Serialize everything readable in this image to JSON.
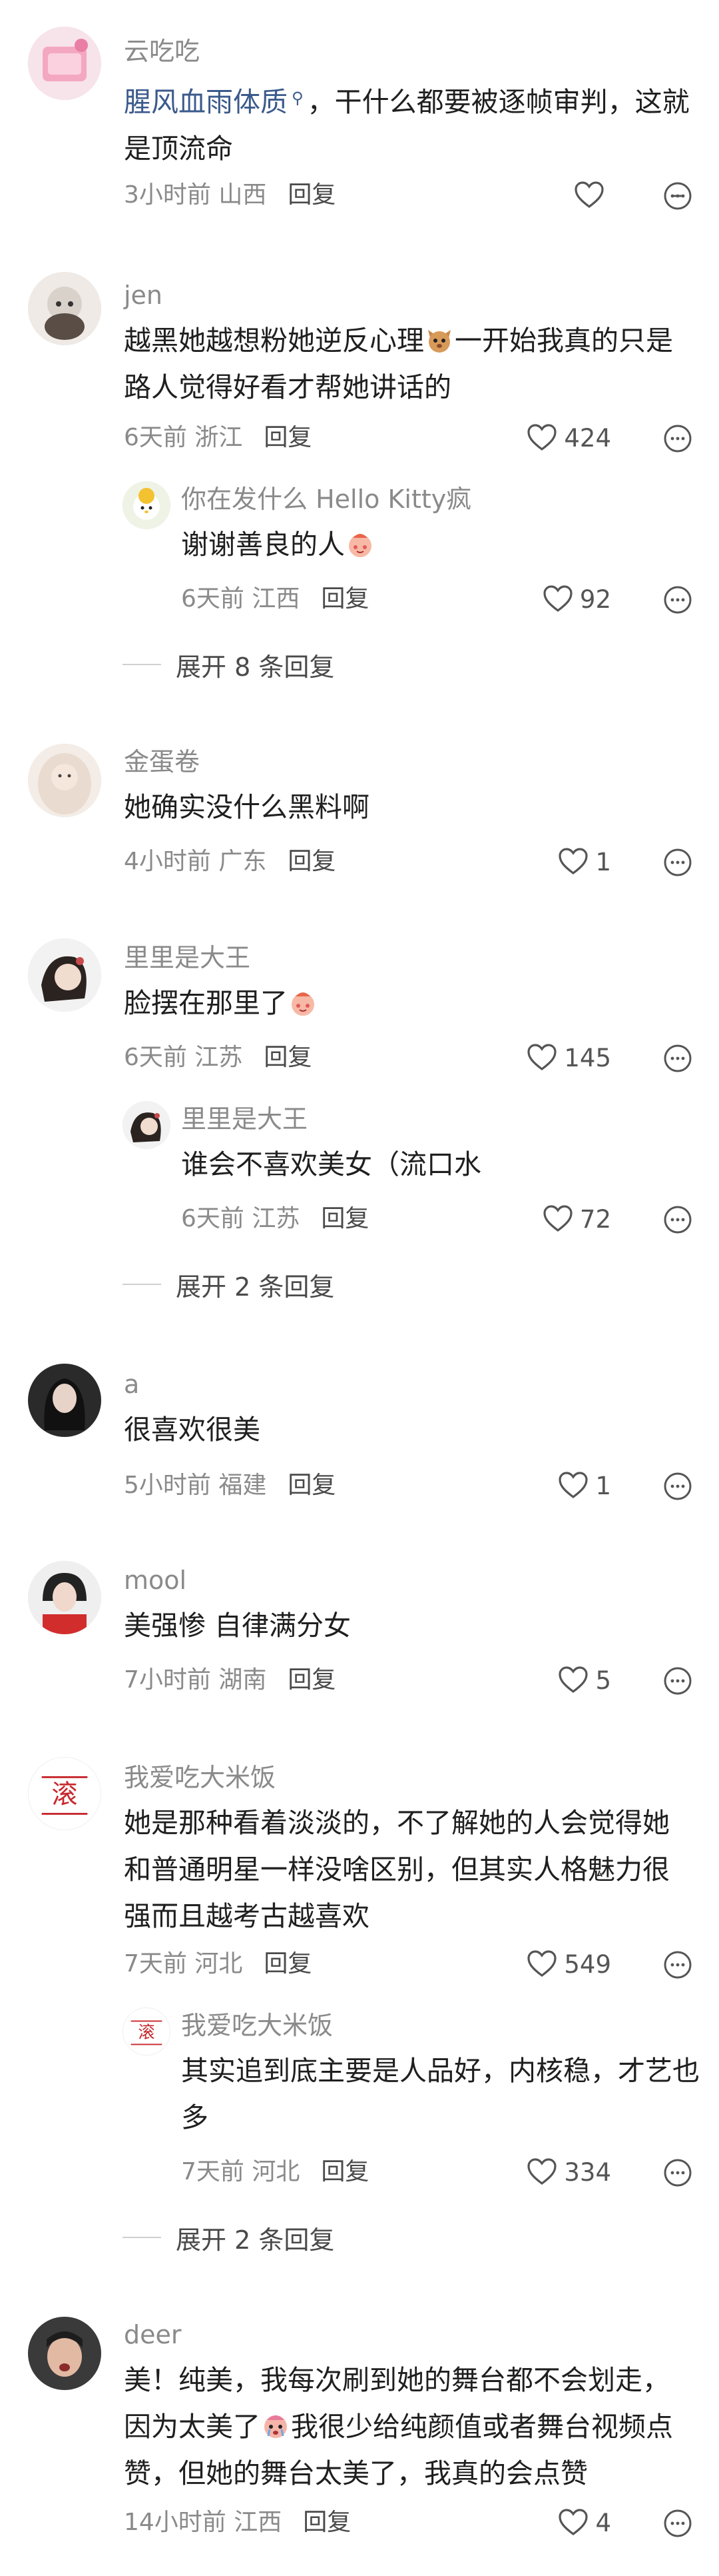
{
  "comments": [
    {
      "user": "云吃吃",
      "text_link": "腥风血雨体质",
      "text_link_icon": "search-icon",
      "text_rest": "，干什么都要被逐帧审判，这就是顶流命",
      "time": "3小时前",
      "location": "山西",
      "reply_label": "回复",
      "likes": ""
    },
    {
      "user": "jen",
      "text_a": "越黑她越想粉她逆反心理",
      "text_emoji": "cat-emoji",
      "text_b": "一开始我真的只是路人觉得好看才帮她讲话的",
      "time": "6天前",
      "location": "浙江",
      "reply_label": "回复",
      "likes": "424",
      "reply": {
        "user": "你在发什么 Hello Kitty疯",
        "text": "谢谢善良的人",
        "text_emoji": "blush-emoji",
        "time": "6天前",
        "location": "江西",
        "reply_label": "回复",
        "likes": "92"
      },
      "expand": "展开 8 条回复"
    },
    {
      "user": "金蛋卷",
      "text": "她确实没什么黑料啊",
      "time": "4小时前",
      "location": "广东",
      "reply_label": "回复",
      "likes": "1"
    },
    {
      "user": "里里是大王",
      "text": "脸摆在那里了",
      "text_emoji": "blush-emoji",
      "time": "6天前",
      "location": "江苏",
      "reply_label": "回复",
      "likes": "145",
      "reply": {
        "user": "里里是大王",
        "text": "谁会不喜欢美女（流口水",
        "time": "6天前",
        "location": "江苏",
        "reply_label": "回复",
        "likes": "72"
      },
      "expand": "展开 2 条回复"
    },
    {
      "user": "a",
      "text": "很喜欢很美",
      "time": "5小时前",
      "location": "福建",
      "reply_label": "回复",
      "likes": "1"
    },
    {
      "user": "mool",
      "text": "美强惨 自律满分女",
      "time": "7小时前",
      "location": "湖南",
      "reply_label": "回复",
      "likes": "5"
    },
    {
      "user": "我爱吃大米饭",
      "text": "她是那种看着淡淡的，不了解她的人会觉得她和普通明星一样没啥区别，但其实人格魅力很强而且越考古越喜欢",
      "time": "7天前",
      "location": "河北",
      "reply_label": "回复",
      "likes": "549",
      "avatar_text": "滚",
      "reply": {
        "user": "我爱吃大米饭",
        "text": "其实追到底主要是人品好，内核稳，才艺也多",
        "time": "7天前",
        "location": "河北",
        "reply_label": "回复",
        "likes": "334",
        "avatar_text": "滚"
      },
      "expand": "展开 2 条回复"
    },
    {
      "user": "deer",
      "text_a": "美！纯美，我每次刷到她的舞台都不会划走，因为太美了",
      "text_emoji": "crying-emoji",
      "text_b": "我很少给纯颜值或者舞台视频点赞，但她的舞台太美了，我真的会点赞",
      "time": "14小时前",
      "location": "江西",
      "reply_label": "回复",
      "likes": "4"
    }
  ],
  "colors": {
    "username": "#8a8a8a",
    "text": "#1f1f1f",
    "link": "#3b5a8c",
    "meta": "#8a8a8a",
    "reply": "#4a4a4a"
  }
}
